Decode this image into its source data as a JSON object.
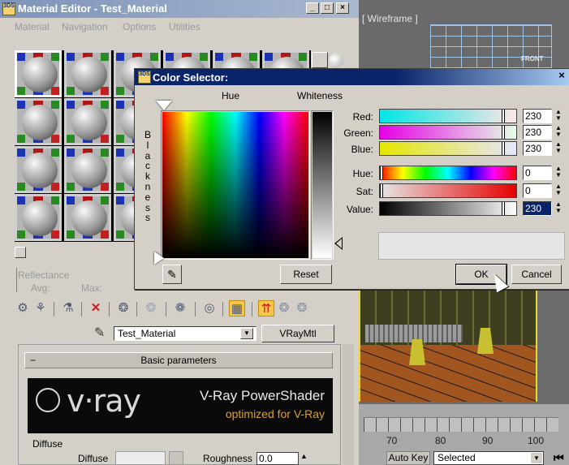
{
  "material_editor": {
    "title": "Material Editor - Test_Material",
    "icon_text": "3DS",
    "menu": [
      "Material",
      "Navigation",
      "Options",
      "Utilities"
    ],
    "reflectance_label": "Reflectance",
    "avg_label": "Avg:",
    "max_label": "Max:",
    "material_name": "Test_Material",
    "material_type": "VRayMtl",
    "basic_params_label": "Basic parameters",
    "vray_logo": "v·ray",
    "vray_banner_line1": "V-Ray PowerShader",
    "vray_banner_line2": "optimized for V-Ray",
    "diffuse_group": "Diffuse",
    "diffuse_label": "Diffuse",
    "roughness_label": "Roughness",
    "roughness_value": "0.0"
  },
  "viewport": {
    "top_label": "[ Wireframe ]",
    "front_label": "FRONT",
    "timeline_ticks": [
      "70",
      "80",
      "90",
      "100"
    ],
    "auto_key_label": "Auto Key",
    "selected_value": "Selected"
  },
  "color_selector": {
    "title": "Color Selector:",
    "hue_label": "Hue",
    "whiteness_label": "Whiteness",
    "blackness_label": "Blackness",
    "rows": [
      {
        "label": "Red:",
        "value": "230"
      },
      {
        "label": "Green:",
        "value": "230"
      },
      {
        "label": "Blue:",
        "value": "230"
      },
      {
        "label": "Hue:",
        "value": "0"
      },
      {
        "label": "Sat:",
        "value": "0"
      },
      {
        "label": "Value:",
        "value": "230"
      }
    ],
    "reset_label": "Reset",
    "ok_label": "OK",
    "cancel_label": "Cancel",
    "preview_color": "#e6e6e6"
  }
}
